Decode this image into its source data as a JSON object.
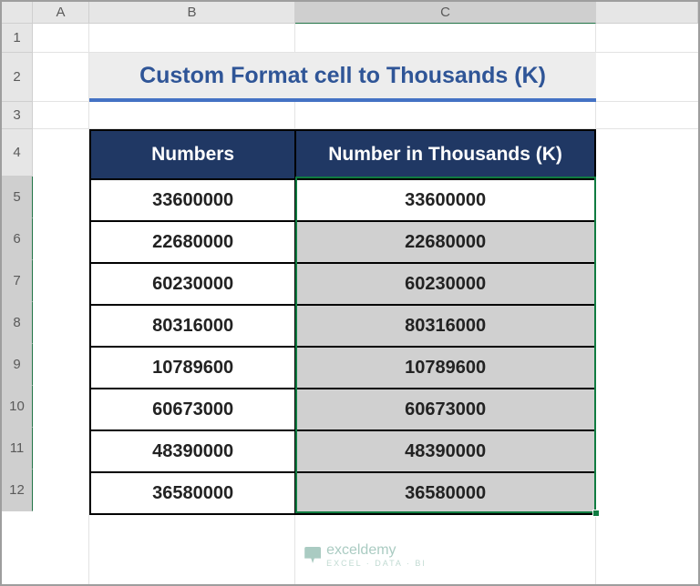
{
  "columns": {
    "A": "A",
    "B": "B",
    "C": "C"
  },
  "rows": [
    "1",
    "2",
    "3",
    "4",
    "5",
    "6",
    "7",
    "8",
    "9",
    "10",
    "11",
    "12"
  ],
  "title": "Custom Format cell to Thousands (K)",
  "headers": {
    "b": "Numbers",
    "c": "Number in Thousands (K)"
  },
  "data": [
    {
      "b": "33600000",
      "c": "33600000"
    },
    {
      "b": "22680000",
      "c": "22680000"
    },
    {
      "b": "60230000",
      "c": "60230000"
    },
    {
      "b": "80316000",
      "c": "80316000"
    },
    {
      "b": "10789600",
      "c": "10789600"
    },
    {
      "b": "60673000",
      "c": "60673000"
    },
    {
      "b": "48390000",
      "c": "48390000"
    },
    {
      "b": "36580000",
      "c": "36580000"
    }
  ],
  "watermark": {
    "name": "exceldemy",
    "sub": "EXCEL · DATA · BI"
  }
}
